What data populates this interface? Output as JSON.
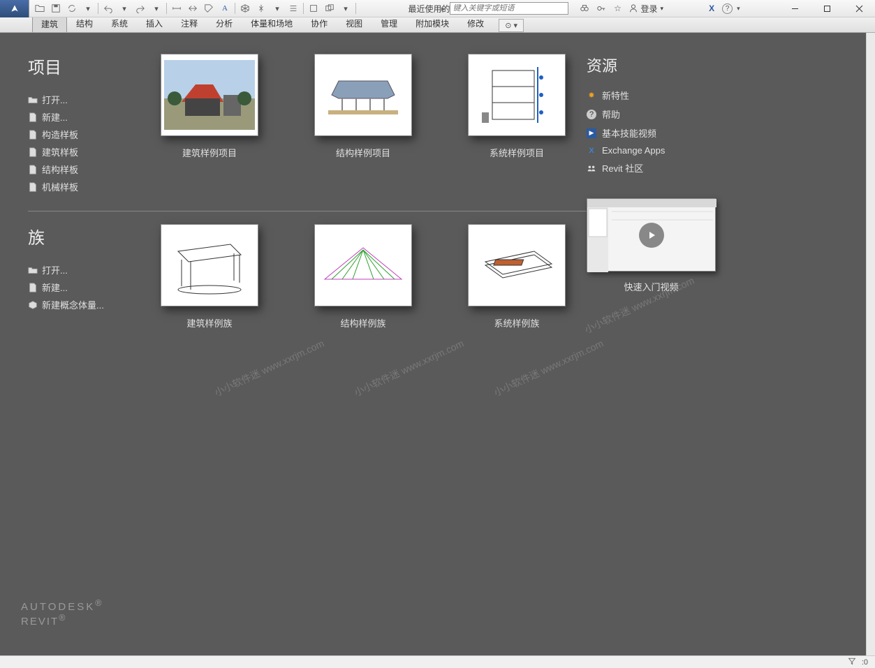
{
  "titlebar": {
    "title": "最近使用的文件",
    "search_placeholder": "键入关键字或短语",
    "login": "登录"
  },
  "ribbon": {
    "tabs": [
      "建筑",
      "结构",
      "系统",
      "插入",
      "注释",
      "分析",
      "体量和场地",
      "协作",
      "视图",
      "管理",
      "附加模块",
      "修改"
    ],
    "active_index": 0
  },
  "projects": {
    "title": "项目",
    "links": [
      "打开...",
      "新建...",
      "构造样板",
      "建筑样板",
      "结构样板",
      "机械样板"
    ],
    "thumbs": [
      "建筑样例项目",
      "结构样例项目",
      "系统样例项目"
    ]
  },
  "families": {
    "title": "族",
    "links": [
      "打开...",
      "新建...",
      "新建概念体量..."
    ],
    "thumbs": [
      "建筑样例族",
      "结构样例族",
      "系统样例族"
    ]
  },
  "resources": {
    "title": "资源",
    "items": [
      "新特性",
      "帮助",
      "基本技能视频",
      "Exchange Apps",
      "Revit 社区"
    ],
    "video_label": "快速入门视频"
  },
  "branding": {
    "line1": "AUTODESK",
    "line2": "REVIT"
  },
  "statusbar": {
    "filter_count": ":0"
  },
  "watermark": "小小软件迷  www.xxrjm.com"
}
